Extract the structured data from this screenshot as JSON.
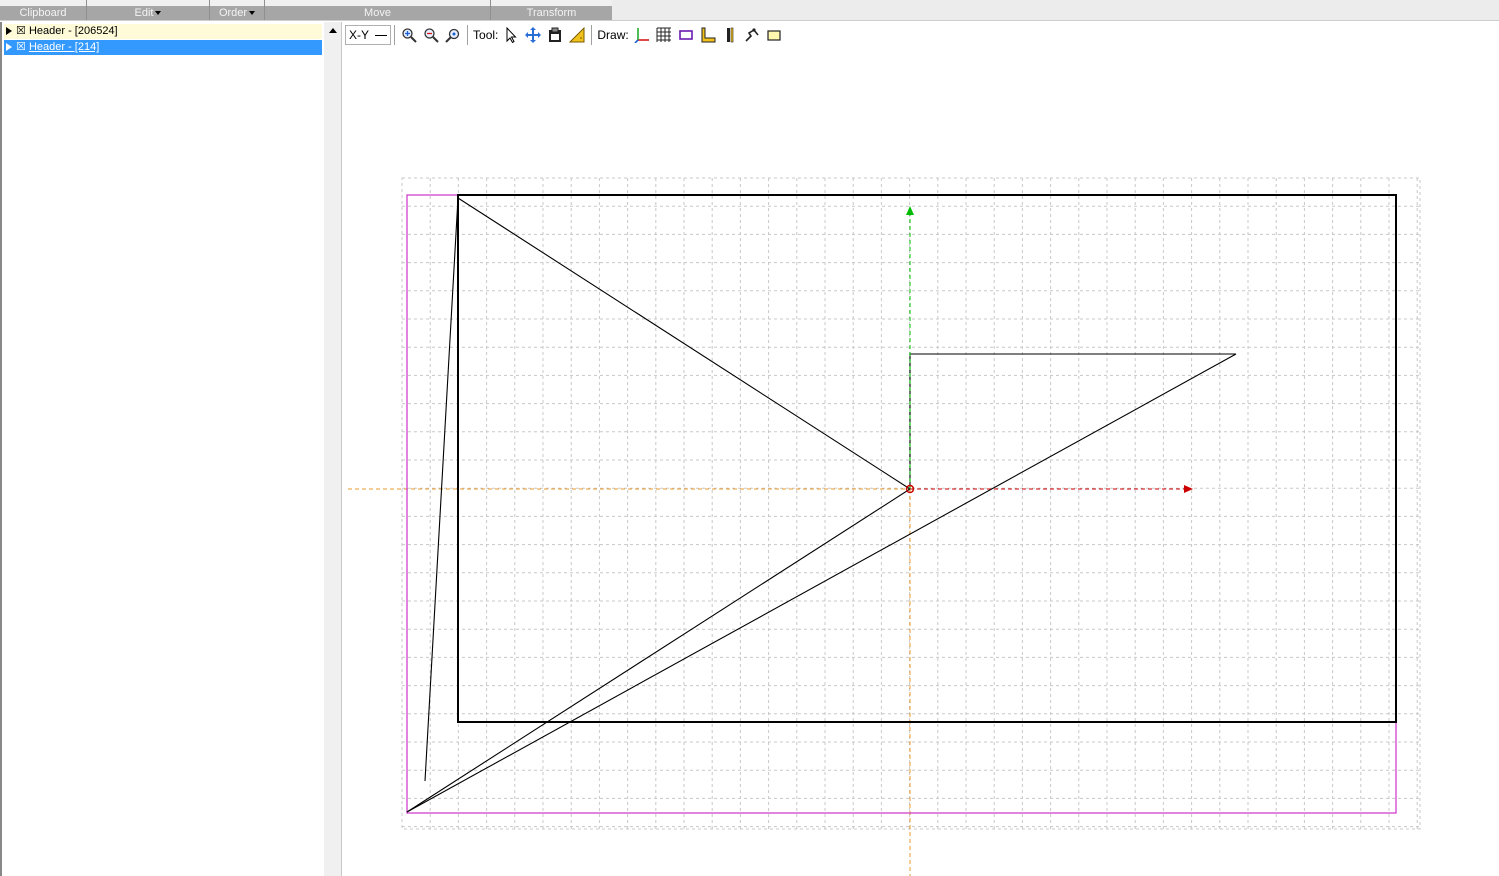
{
  "ribbon": {
    "groups": [
      {
        "label": "Clipboard"
      },
      {
        "label": "Edit"
      },
      {
        "label": "Order"
      },
      {
        "label": "Move"
      },
      {
        "label": "Transform"
      }
    ]
  },
  "tree": {
    "items": [
      {
        "label": "Header - [206524]",
        "checkbox": "☒",
        "selected": false
      },
      {
        "label": "Header - [214]",
        "checkbox": "☒",
        "selected": true
      }
    ]
  },
  "toolbar": {
    "view_select": "X-Y",
    "tool_label": "Tool:",
    "draw_label": "Draw:",
    "icons": {
      "zoom_in": "zoom-in-icon",
      "zoom_out": "zoom-out-icon",
      "zoom_fit": "zoom-fit-icon",
      "select": "pointer-icon",
      "pan": "move-icon",
      "clipboard": "clipboard-icon",
      "measure": "ruler-icon",
      "axes": "axes-icon",
      "grid": "grid-icon",
      "rect": "rectangle-icon",
      "corner": "corner-icon",
      "vertical": "vertical-bars-icon",
      "path": "path-icon",
      "box": "box-icon"
    }
  },
  "colors": {
    "selection": "#3399ff",
    "grid": "#c8c8c8",
    "outline": "#000000",
    "bounds": "#cc33cc",
    "axis_x": "#cc0000",
    "axis_y": "#00bb00",
    "origin_guide": "#e89a2c"
  }
}
